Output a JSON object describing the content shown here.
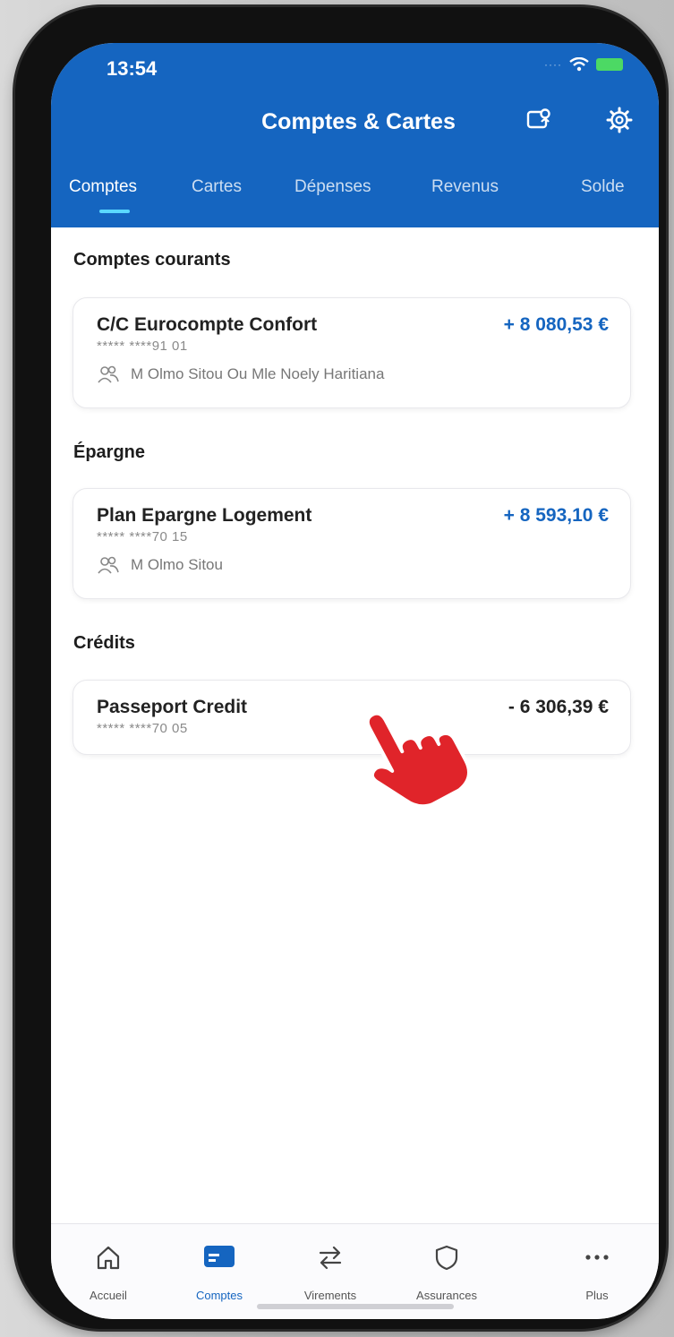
{
  "status_bar": {
    "time": "13:54"
  },
  "header": {
    "title": "Comptes & Cartes"
  },
  "tabs": [
    {
      "label": "Comptes",
      "active": true
    },
    {
      "label": "Cartes",
      "active": false
    },
    {
      "label": "Dépenses",
      "active": false
    },
    {
      "label": "Revenus",
      "active": false
    },
    {
      "label": "Solde",
      "active": false
    }
  ],
  "sections": [
    {
      "title": "Comptes courants",
      "accounts": [
        {
          "name": "C/C Eurocompte Confort",
          "number": "***** ****91 01",
          "amount": "+ 8 080,53 €",
          "holder": "M Olmo Sitou Ou Mle Noely Haritiana"
        }
      ]
    },
    {
      "title": "Épargne",
      "accounts": [
        {
          "name": "Plan Epargne Logement",
          "number": "***** ****70 15",
          "amount": "+ 8 593,10 €",
          "holder": "M Olmo Sitou"
        }
      ]
    },
    {
      "title": "Crédits",
      "accounts": [
        {
          "name": "Passeport Credit",
          "number": "***** ****70 05",
          "amount": "- 6 306,39 €"
        }
      ]
    }
  ],
  "bottom_nav": [
    {
      "label": "Accueil",
      "icon": "home-icon",
      "active": false
    },
    {
      "label": "Comptes",
      "icon": "card-icon",
      "active": true
    },
    {
      "label": "Virements",
      "icon": "transfer-icon",
      "active": false
    },
    {
      "label": "Assurances",
      "icon": "shield-icon",
      "active": false
    },
    {
      "label": "Plus",
      "icon": "more-icon",
      "active": false
    }
  ],
  "colors": {
    "brand": "#1565c0",
    "positive": "#1565c0",
    "tab_indicator": "#5ad8ff",
    "pointer": "#e0242a"
  }
}
